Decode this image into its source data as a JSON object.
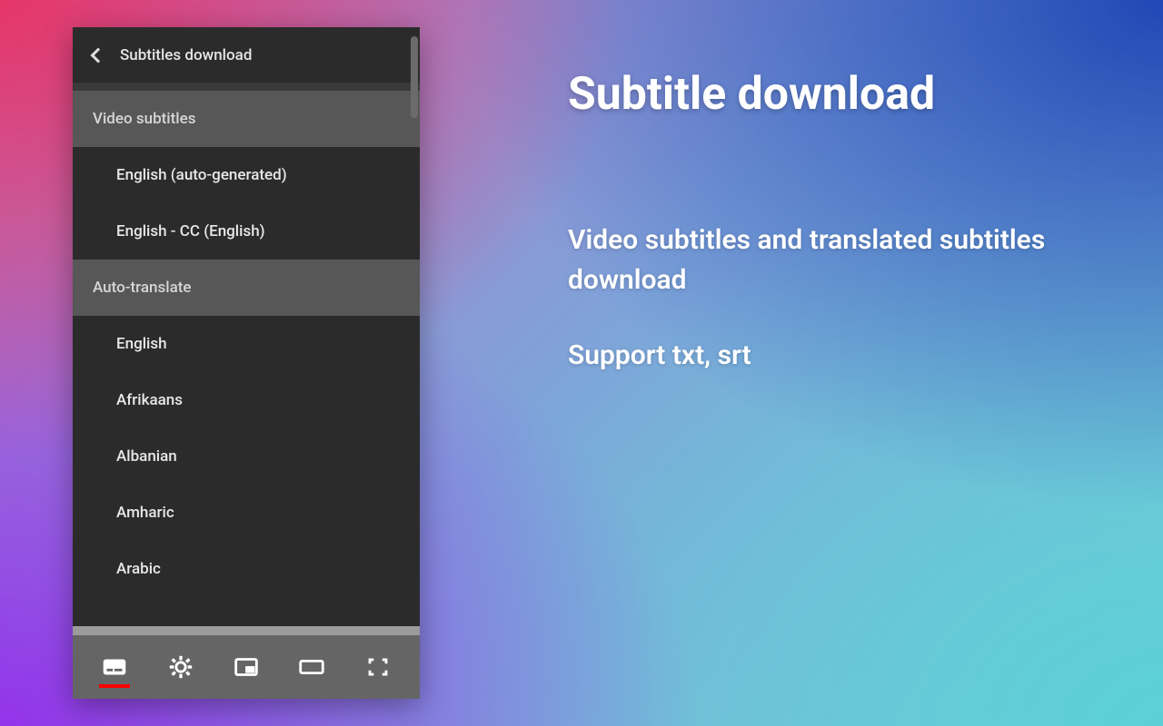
{
  "menu": {
    "title": "Subtitles download",
    "sections": [
      {
        "header": "Video subtitles",
        "items": [
          "English (auto-generated)",
          "English - CC (English)"
        ]
      },
      {
        "header": "Auto-translate",
        "items": [
          "English",
          "Afrikaans",
          "Albanian",
          "Amharic",
          "Arabic"
        ]
      }
    ]
  },
  "controls": {
    "cc": "captions-icon",
    "settings": "gear-icon",
    "miniplayer": "miniplayer-icon",
    "theater": "theater-icon",
    "fullscreen": "fullscreen-icon"
  },
  "marketing": {
    "title": "Subtitle download",
    "line1": "Video subtitles and translated subtitles download",
    "line2": "Support txt, srt"
  }
}
